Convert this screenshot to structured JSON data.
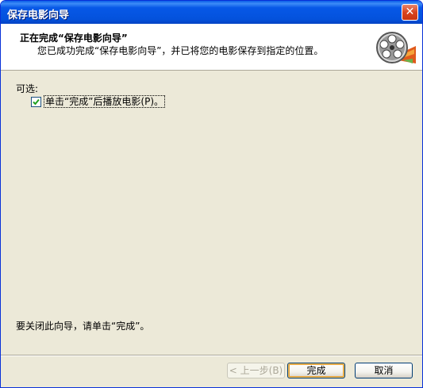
{
  "window": {
    "title": "保存电影向导",
    "close_glyph": "✕"
  },
  "header": {
    "title": "正在完成“保存电影向导”",
    "description": "您已成功完成“保存电影向导”，并已将您的电影保存到指定的位置。",
    "icon": "film-reel-icon"
  },
  "body": {
    "optional_label": "可选:",
    "checkbox": {
      "label": "单击“完成”后播放电影(P)。",
      "checked": true
    },
    "finish_hint": "要关闭此向导，请单击“完成”。"
  },
  "buttons": {
    "back": "< 上一步(B)",
    "finish": "完成",
    "cancel": "取消"
  },
  "colors": {
    "titlebar": "#0452dc",
    "window_bg": "#ece9d8",
    "checkmark": "#21a121"
  }
}
